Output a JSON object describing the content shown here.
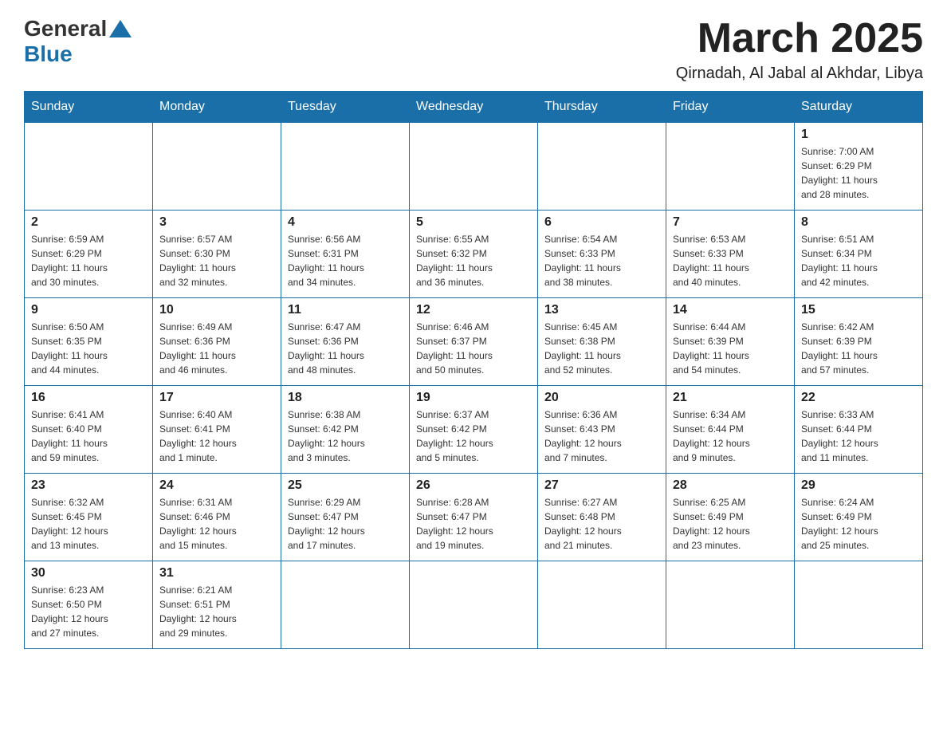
{
  "header": {
    "logo_general": "General",
    "logo_blue": "Blue",
    "month": "March 2025",
    "location": "Qirnadah, Al Jabal al Akhdar, Libya"
  },
  "weekdays": [
    "Sunday",
    "Monday",
    "Tuesday",
    "Wednesday",
    "Thursday",
    "Friday",
    "Saturday"
  ],
  "weeks": [
    [
      {
        "day": "",
        "info": ""
      },
      {
        "day": "",
        "info": ""
      },
      {
        "day": "",
        "info": ""
      },
      {
        "day": "",
        "info": ""
      },
      {
        "day": "",
        "info": ""
      },
      {
        "day": "",
        "info": ""
      },
      {
        "day": "1",
        "info": "Sunrise: 7:00 AM\nSunset: 6:29 PM\nDaylight: 11 hours\nand 28 minutes."
      }
    ],
    [
      {
        "day": "2",
        "info": "Sunrise: 6:59 AM\nSunset: 6:29 PM\nDaylight: 11 hours\nand 30 minutes."
      },
      {
        "day": "3",
        "info": "Sunrise: 6:57 AM\nSunset: 6:30 PM\nDaylight: 11 hours\nand 32 minutes."
      },
      {
        "day": "4",
        "info": "Sunrise: 6:56 AM\nSunset: 6:31 PM\nDaylight: 11 hours\nand 34 minutes."
      },
      {
        "day": "5",
        "info": "Sunrise: 6:55 AM\nSunset: 6:32 PM\nDaylight: 11 hours\nand 36 minutes."
      },
      {
        "day": "6",
        "info": "Sunrise: 6:54 AM\nSunset: 6:33 PM\nDaylight: 11 hours\nand 38 minutes."
      },
      {
        "day": "7",
        "info": "Sunrise: 6:53 AM\nSunset: 6:33 PM\nDaylight: 11 hours\nand 40 minutes."
      },
      {
        "day": "8",
        "info": "Sunrise: 6:51 AM\nSunset: 6:34 PM\nDaylight: 11 hours\nand 42 minutes."
      }
    ],
    [
      {
        "day": "9",
        "info": "Sunrise: 6:50 AM\nSunset: 6:35 PM\nDaylight: 11 hours\nand 44 minutes."
      },
      {
        "day": "10",
        "info": "Sunrise: 6:49 AM\nSunset: 6:36 PM\nDaylight: 11 hours\nand 46 minutes."
      },
      {
        "day": "11",
        "info": "Sunrise: 6:47 AM\nSunset: 6:36 PM\nDaylight: 11 hours\nand 48 minutes."
      },
      {
        "day": "12",
        "info": "Sunrise: 6:46 AM\nSunset: 6:37 PM\nDaylight: 11 hours\nand 50 minutes."
      },
      {
        "day": "13",
        "info": "Sunrise: 6:45 AM\nSunset: 6:38 PM\nDaylight: 11 hours\nand 52 minutes."
      },
      {
        "day": "14",
        "info": "Sunrise: 6:44 AM\nSunset: 6:39 PM\nDaylight: 11 hours\nand 54 minutes."
      },
      {
        "day": "15",
        "info": "Sunrise: 6:42 AM\nSunset: 6:39 PM\nDaylight: 11 hours\nand 57 minutes."
      }
    ],
    [
      {
        "day": "16",
        "info": "Sunrise: 6:41 AM\nSunset: 6:40 PM\nDaylight: 11 hours\nand 59 minutes."
      },
      {
        "day": "17",
        "info": "Sunrise: 6:40 AM\nSunset: 6:41 PM\nDaylight: 12 hours\nand 1 minute."
      },
      {
        "day": "18",
        "info": "Sunrise: 6:38 AM\nSunset: 6:42 PM\nDaylight: 12 hours\nand 3 minutes."
      },
      {
        "day": "19",
        "info": "Sunrise: 6:37 AM\nSunset: 6:42 PM\nDaylight: 12 hours\nand 5 minutes."
      },
      {
        "day": "20",
        "info": "Sunrise: 6:36 AM\nSunset: 6:43 PM\nDaylight: 12 hours\nand 7 minutes."
      },
      {
        "day": "21",
        "info": "Sunrise: 6:34 AM\nSunset: 6:44 PM\nDaylight: 12 hours\nand 9 minutes."
      },
      {
        "day": "22",
        "info": "Sunrise: 6:33 AM\nSunset: 6:44 PM\nDaylight: 12 hours\nand 11 minutes."
      }
    ],
    [
      {
        "day": "23",
        "info": "Sunrise: 6:32 AM\nSunset: 6:45 PM\nDaylight: 12 hours\nand 13 minutes."
      },
      {
        "day": "24",
        "info": "Sunrise: 6:31 AM\nSunset: 6:46 PM\nDaylight: 12 hours\nand 15 minutes."
      },
      {
        "day": "25",
        "info": "Sunrise: 6:29 AM\nSunset: 6:47 PM\nDaylight: 12 hours\nand 17 minutes."
      },
      {
        "day": "26",
        "info": "Sunrise: 6:28 AM\nSunset: 6:47 PM\nDaylight: 12 hours\nand 19 minutes."
      },
      {
        "day": "27",
        "info": "Sunrise: 6:27 AM\nSunset: 6:48 PM\nDaylight: 12 hours\nand 21 minutes."
      },
      {
        "day": "28",
        "info": "Sunrise: 6:25 AM\nSunset: 6:49 PM\nDaylight: 12 hours\nand 23 minutes."
      },
      {
        "day": "29",
        "info": "Sunrise: 6:24 AM\nSunset: 6:49 PM\nDaylight: 12 hours\nand 25 minutes."
      }
    ],
    [
      {
        "day": "30",
        "info": "Sunrise: 6:23 AM\nSunset: 6:50 PM\nDaylight: 12 hours\nand 27 minutes."
      },
      {
        "day": "31",
        "info": "Sunrise: 6:21 AM\nSunset: 6:51 PM\nDaylight: 12 hours\nand 29 minutes."
      },
      {
        "day": "",
        "info": ""
      },
      {
        "day": "",
        "info": ""
      },
      {
        "day": "",
        "info": ""
      },
      {
        "day": "",
        "info": ""
      },
      {
        "day": "",
        "info": ""
      }
    ]
  ]
}
